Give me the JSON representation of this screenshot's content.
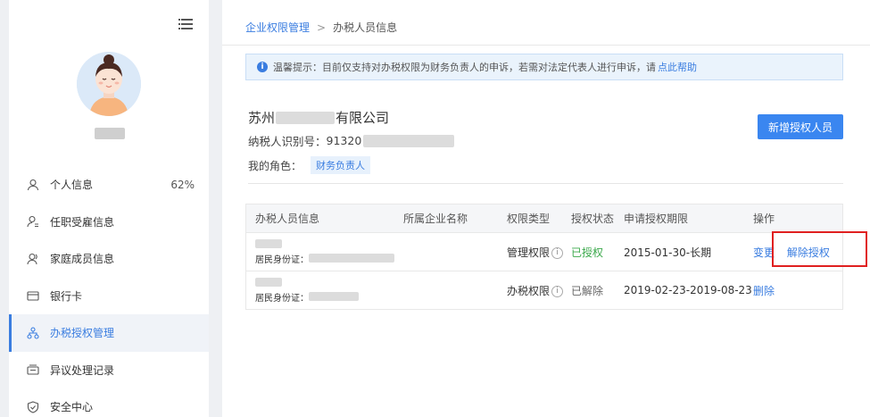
{
  "sidebar": {
    "items": [
      {
        "label": "个人信息",
        "icon": "person-icon",
        "percent": "62%"
      },
      {
        "label": "任职受雇信息",
        "icon": "employee-icon"
      },
      {
        "label": "家庭成员信息",
        "icon": "family-icon"
      },
      {
        "label": "银行卡",
        "icon": "card-icon"
      },
      {
        "label": "办税授权管理",
        "icon": "org-icon",
        "active": true
      },
      {
        "label": "异议处理记录",
        "icon": "record-icon"
      },
      {
        "label": "安全中心",
        "icon": "shield-icon"
      }
    ]
  },
  "breadcrumb": {
    "parent": "企业权限管理",
    "separator": ">",
    "current": "办税人员信息"
  },
  "notice": {
    "text": "温馨提示：目前仅支持对办税权限为财务负责人的申诉，若需对法定代表人进行申诉，请",
    "link": "点此帮助"
  },
  "company": {
    "name_prefix": "苏州",
    "name_suffix": "有限公司",
    "taxid_label": "纳税人识别号：",
    "taxid_prefix": "91320",
    "role_label": "我的角色：",
    "role": "财务负责人"
  },
  "add_button": "新增授权人员",
  "table": {
    "headers": [
      "办税人员信息",
      "所属企业名称",
      "权限类型",
      "授权状态",
      "申请授权期限",
      "操作"
    ],
    "rows": [
      {
        "id_label": "居民身份证：",
        "perm": "管理权限",
        "status": "已授权",
        "period": "2015-01-30-长期",
        "ops": [
          "变更",
          "解除授权"
        ]
      },
      {
        "id_label": "居民身份证：",
        "perm": "办税权限",
        "status": "已解除",
        "period": "2019-02-23-2019-08-23",
        "ops": [
          "删除"
        ]
      }
    ]
  },
  "colors": {
    "accent": "#3a7de0",
    "success": "#3aa84a",
    "highlight": "#e02020"
  }
}
